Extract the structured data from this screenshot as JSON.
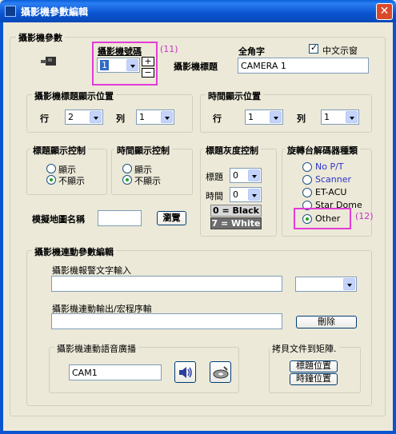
{
  "window": {
    "title": "攝影機參數編輯",
    "close_glyph": "✕"
  },
  "camera_params": {
    "group_title": "攝影機參數",
    "camera_number_label": "攝影機號碼",
    "camera_number_value": "1",
    "fullwidth_label": "全角字",
    "chinese_display_label": "中文示窗",
    "chinese_display_checked": true,
    "camera_title_label": "攝影機標題",
    "camera_title_value": "CAMERA 1",
    "annotation_11": "(11)",
    "stepper_plus": "+",
    "stepper_minus": "−"
  },
  "title_pos": {
    "group_title": "攝影機標題顯示位置",
    "row_label": "行",
    "row_value": "2",
    "col_label": "列",
    "col_value": "1"
  },
  "time_pos": {
    "group_title": "時間顯示位置",
    "row_label": "行",
    "row_value": "1",
    "col_label": "列",
    "col_value": "1"
  },
  "title_display": {
    "group_title": "標題顯示控制",
    "show": "顯示",
    "hide": "不顯示",
    "selected": "hide"
  },
  "time_display": {
    "group_title": "時間顯示控制",
    "show": "顯示",
    "hide": "不顯示",
    "selected": "hide"
  },
  "gray_level": {
    "group_title": "標題灰度控制",
    "title_label": "標題",
    "title_value": "0",
    "time_label": "時間",
    "time_value": "0",
    "black_hint": "0 = Black",
    "white_hint": "7 = White"
  },
  "decoder_type": {
    "group_title": "旋轉台解碼器種類",
    "options": [
      "No P/T",
      "Scanner",
      "ET-ACU",
      "Star Dome",
      "Other"
    ],
    "selected": "Other",
    "annotation_12": "(12)"
  },
  "map_name": {
    "label": "模擬地圖名稱",
    "value": "",
    "browse_label": "瀏覽"
  },
  "linkage": {
    "group_title": "攝影機連動參數編輯",
    "alarm_text_label": "攝影機報警文字輸入",
    "alarm_text_value": "",
    "alarm_combo_value": "",
    "macro_label": "攝影機連動輸出/宏程序輸",
    "macro_value": "",
    "delete_label": "刪除",
    "voice_group_title": "攝影機連動語音廣播",
    "voice_value": "CAM1",
    "copy_group_title": "拷貝文件到矩陣.",
    "title_pos_button": "標題位置",
    "clock_pos_button": "時鐘位置"
  },
  "colors": {
    "title_bar": "#0a54d0",
    "annotation": "#e33cd6",
    "radio_blue_text": "#2b32c9"
  }
}
